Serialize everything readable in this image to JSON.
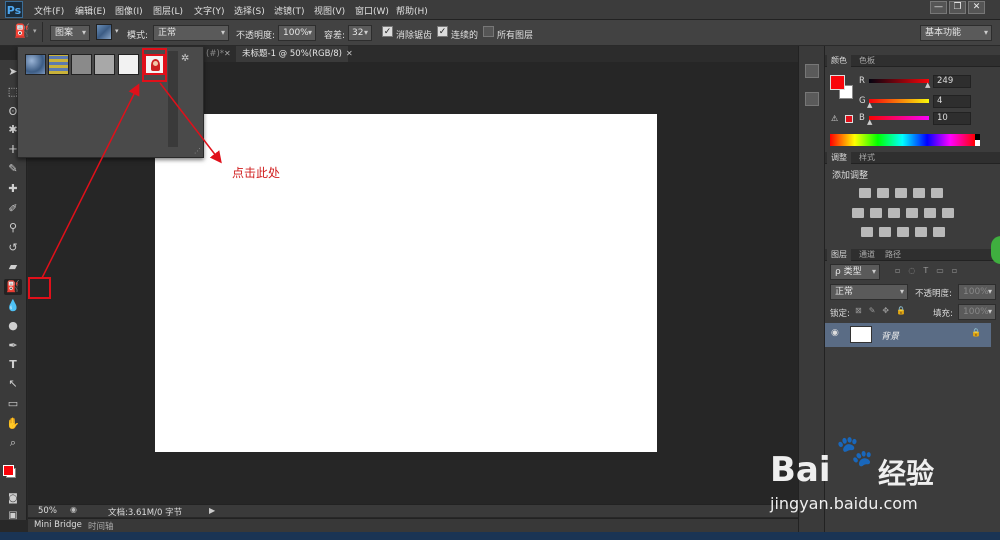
{
  "app": {
    "logo": "Ps"
  },
  "menu": [
    "文件(F)",
    "编辑(E)",
    "图像(I)",
    "图层(L)",
    "文字(Y)",
    "选择(S)",
    "滤镜(T)",
    "视图(V)",
    "窗口(W)",
    "帮助(H)"
  ],
  "window_controls": [
    "—",
    "❐",
    "✕"
  ],
  "options": {
    "fill_source": "图案",
    "mode_label": "模式:",
    "mode_value": "正常",
    "opacity_label": "不透明度:",
    "opacity_value": "100%",
    "tolerance_label": "容差:",
    "tolerance_value": "32",
    "antialias_label": "消除锯齿",
    "contiguous_label": "连续的",
    "all_layers_label": "所有图层",
    "workspace": "基本功能"
  },
  "tabs": {
    "partial": "(#)*",
    "doc": "未标题-1 @ 50%(RGB/8)"
  },
  "status": {
    "zoom": "50%",
    "doc_info": "文档:3.61M/0 字节"
  },
  "bottom_tabs": [
    "Mini Bridge",
    "时间轴"
  ],
  "color_panel": {
    "tabs": [
      "颜色",
      "色板"
    ],
    "r_label": "R",
    "g_label": "G",
    "b_label": "B",
    "r_value": "249",
    "g_value": "4",
    "b_value": "10",
    "fg_color": "#f9040a"
  },
  "adjust_panel": {
    "tabs": [
      "调整",
      "样式"
    ],
    "title": "添加调整"
  },
  "layers_panel": {
    "tabs": [
      "图层",
      "通道",
      "路径"
    ],
    "filter": "ρ 类型",
    "blend": "正常",
    "opacity_label": "不透明度:",
    "opacity_value": "100%",
    "lock_label": "锁定:",
    "fill_label": "填充:",
    "fill_value": "100%",
    "layer_name": "背景"
  },
  "annotation": {
    "note": "点击此处"
  },
  "watermark": {
    "brand": "Bai",
    "brand2": "经验",
    "url": "jingyan.baidu.com"
  }
}
